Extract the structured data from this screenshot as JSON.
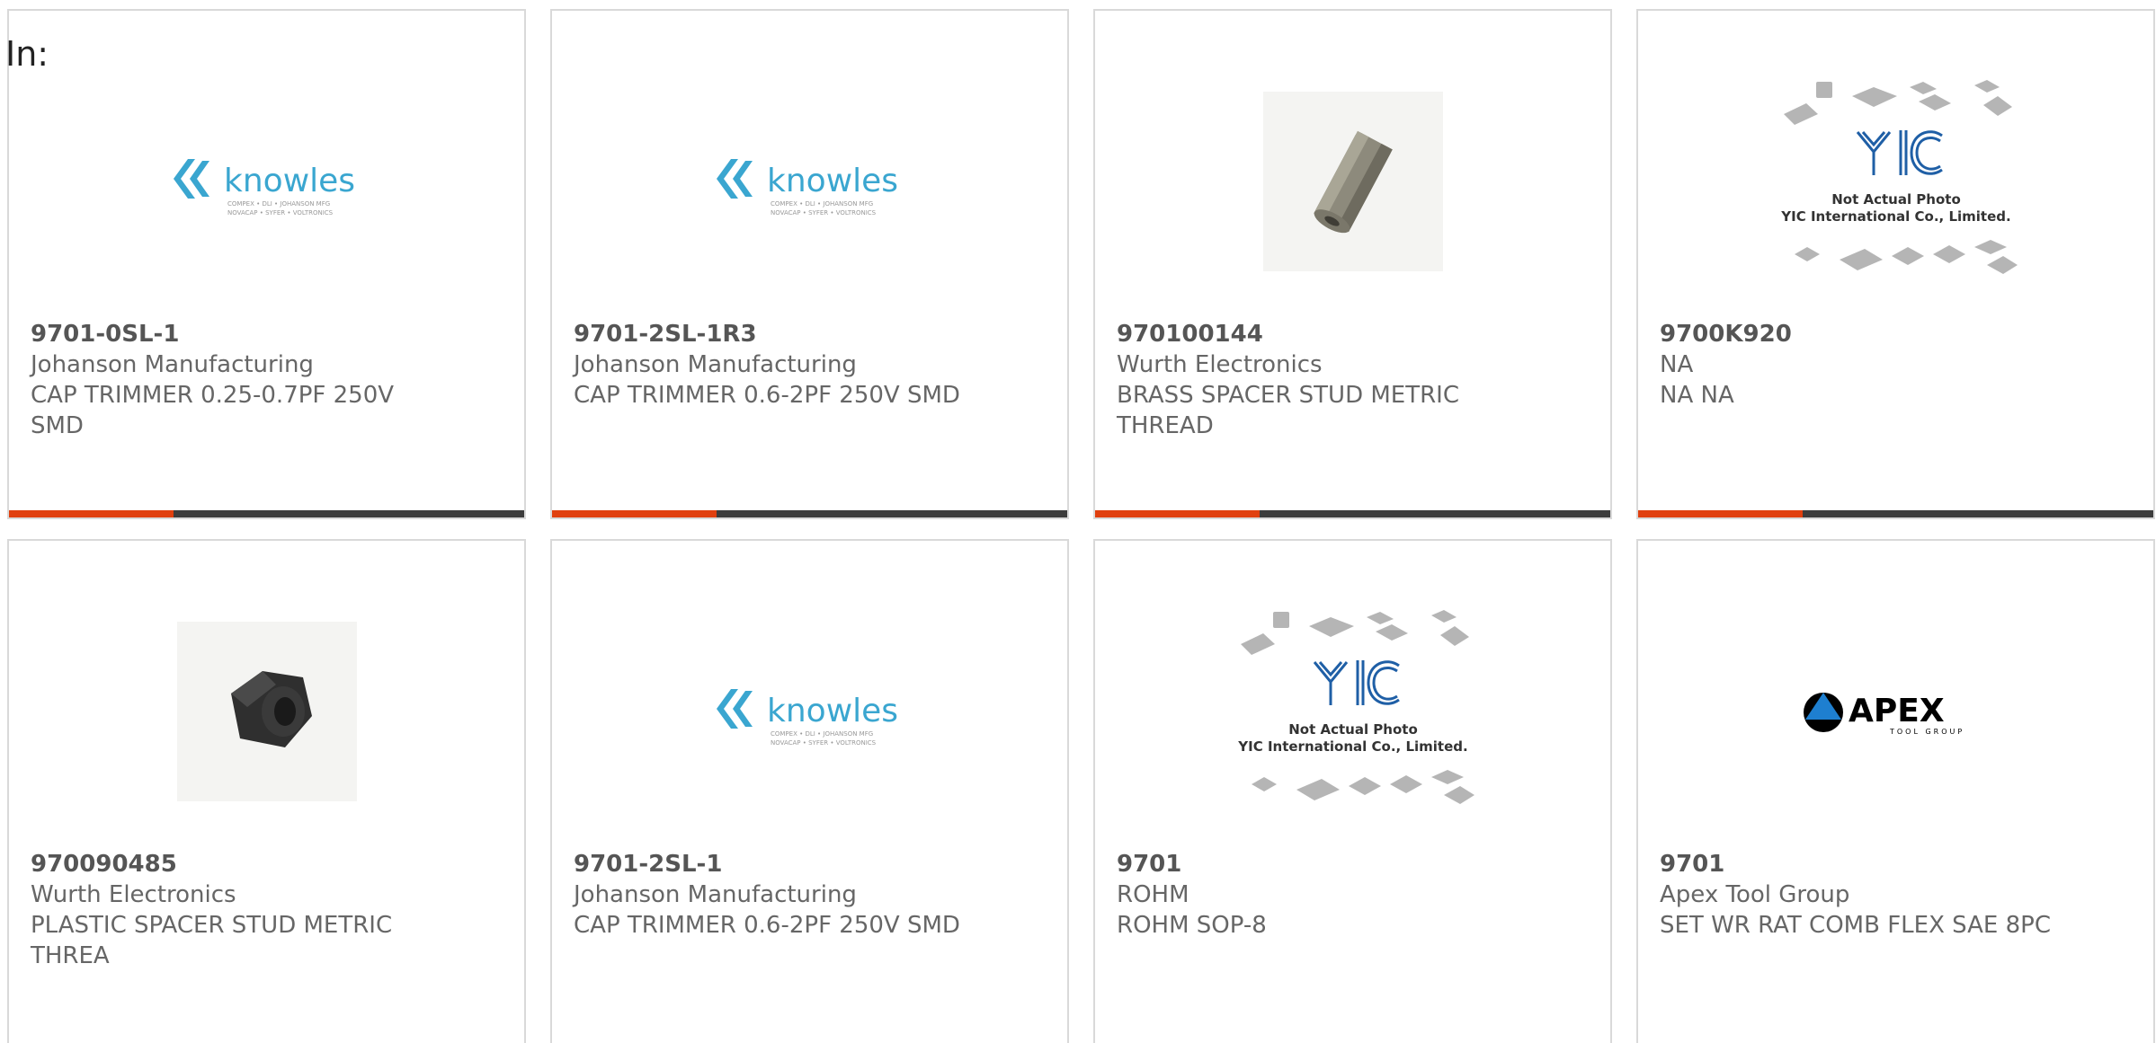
{
  "header": {
    "in_label": "In:"
  },
  "colors": {
    "accent_bar": "#e0400f",
    "dark_bar": "#3c3c3c",
    "text_gray": "#666666",
    "knowles_blue": "#3aa6d0",
    "yic_blue": "#1f5fa6"
  },
  "logo_text": {
    "knowles_word": "knowles",
    "knowles_line1": "COMPEX • DLI • JOHANSON MFG",
    "knowles_line2": "NOVACAP • SYFER • VOLTRONICS",
    "yic_mark": "YIC",
    "yic_caption1": "Not Actual Photo",
    "yic_caption2": "YIC International Co., Limited.",
    "apex_word": "APEX",
    "apex_sub": "TOOL GROUP"
  },
  "products": [
    {
      "part_number": "9701-0SL-1",
      "manufacturer": "Johanson Manufacturing",
      "description": "CAP TRIMMER 0.25-0.7PF 250V SMD",
      "image_icon": "knowles-logo-icon"
    },
    {
      "part_number": "9701-2SL-1R3",
      "manufacturer": "Johanson Manufacturing",
      "description": "CAP TRIMMER 0.6-2PF 250V SMD",
      "image_icon": "knowles-logo-icon"
    },
    {
      "part_number": "970100144",
      "manufacturer": "Wurth Electronics",
      "description": "BRASS SPACER STUD METRIC THREAD",
      "image_icon": "brass-spacer-icon"
    },
    {
      "part_number": "9700K920",
      "manufacturer": "NA",
      "description": "NA NA",
      "image_icon": "yic-placeholder-icon"
    },
    {
      "part_number": "970090485",
      "manufacturer": "Wurth Electronics",
      "description": "PLASTIC SPACER STUD METRIC THREA",
      "image_icon": "plastic-spacer-icon"
    },
    {
      "part_number": "9701-2SL-1",
      "manufacturer": "Johanson Manufacturing",
      "description": "CAP TRIMMER 0.6-2PF 250V SMD",
      "image_icon": "knowles-logo-icon"
    },
    {
      "part_number": "9701",
      "manufacturer": "ROHM",
      "description": "ROHM SOP-8",
      "image_icon": "yic-placeholder-icon"
    },
    {
      "part_number": "9701",
      "manufacturer": "Apex Tool Group",
      "description": "SET WR RAT COMB FLEX SAE 8PC",
      "image_icon": "apex-logo-icon"
    }
  ]
}
